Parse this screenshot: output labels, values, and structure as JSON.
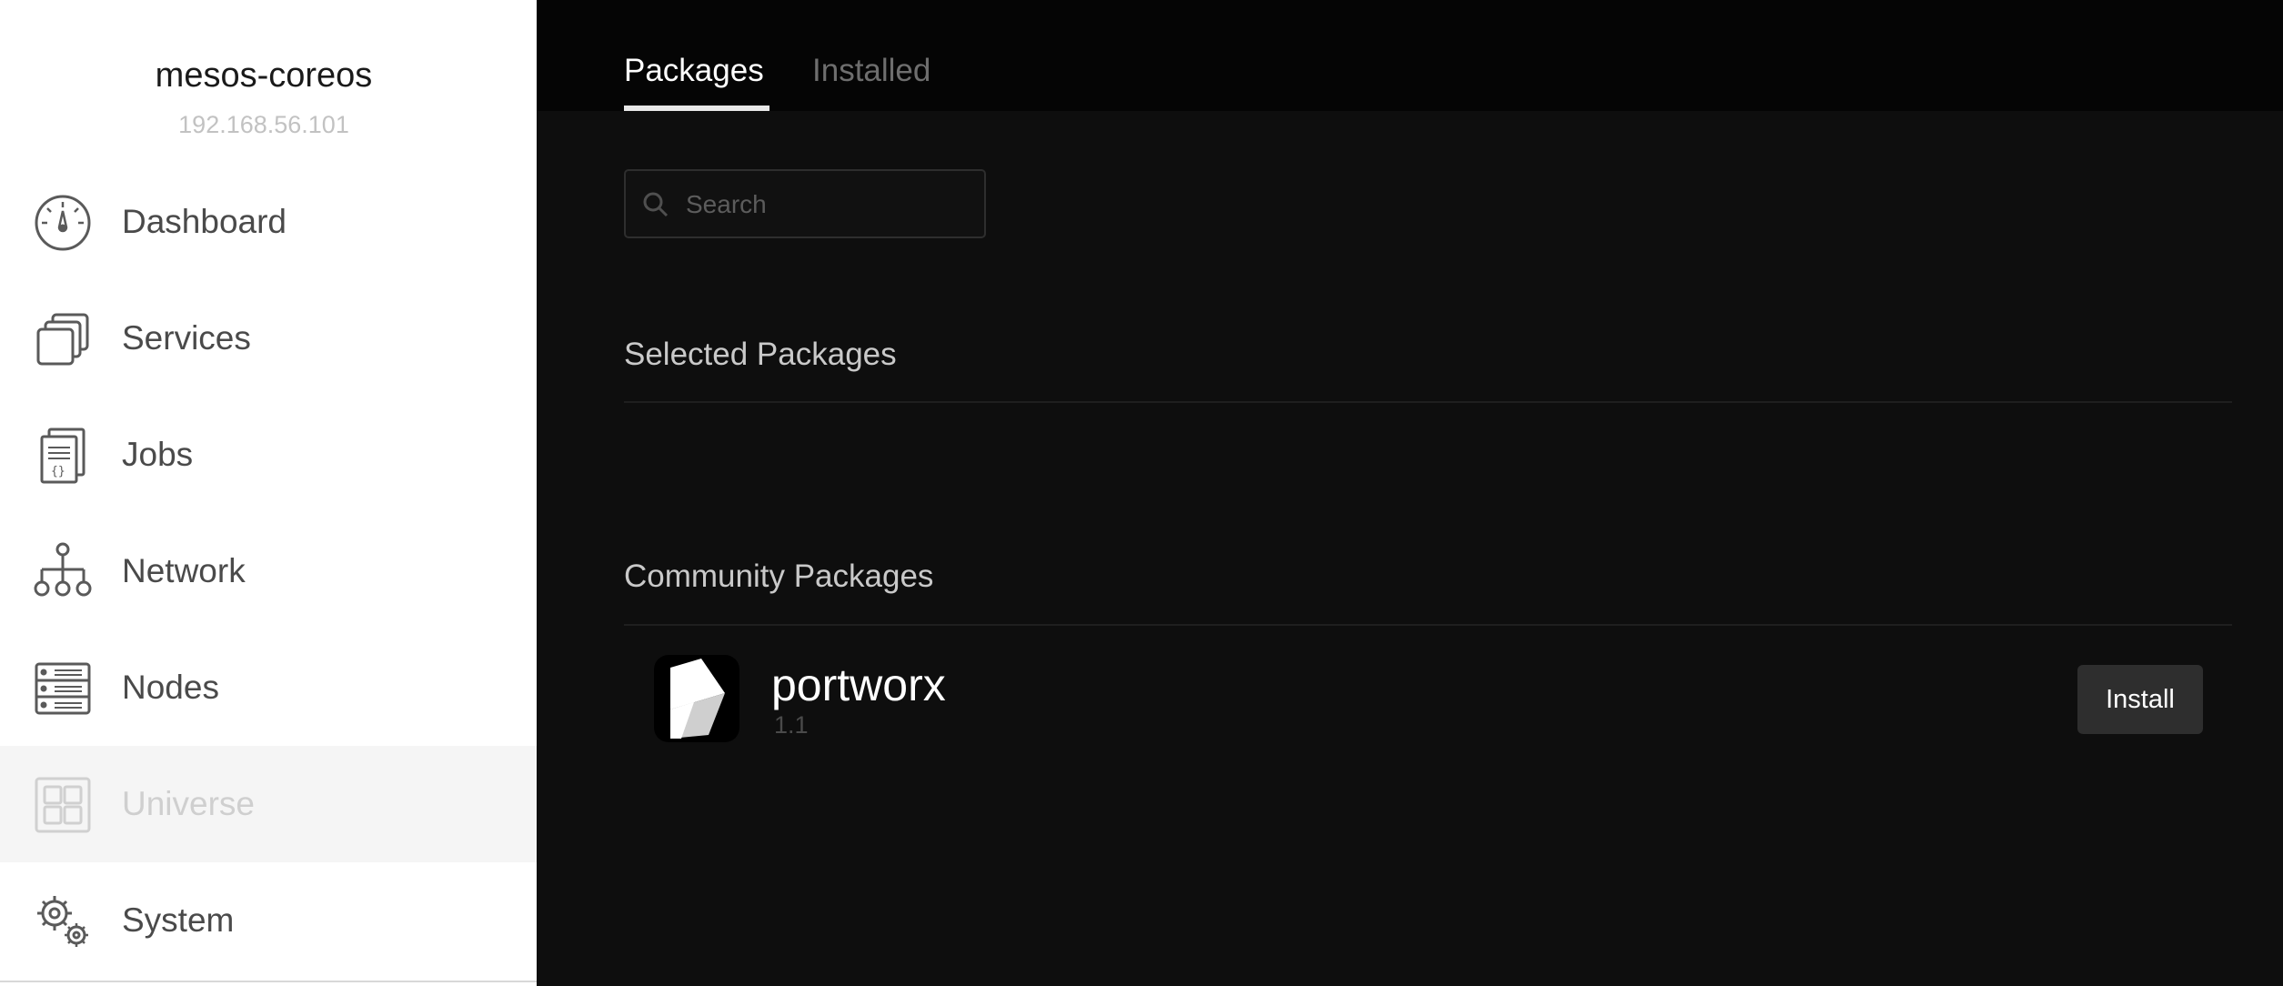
{
  "sidebar": {
    "cluster_name": "mesos-coreos",
    "cluster_ip": "192.168.56.101",
    "items": [
      {
        "label": "Dashboard",
        "icon": "dashboard-gauge-icon",
        "active": false
      },
      {
        "label": "Services",
        "icon": "services-stack-icon",
        "active": false
      },
      {
        "label": "Jobs",
        "icon": "jobs-document-icon",
        "active": false
      },
      {
        "label": "Network",
        "icon": "network-tree-icon",
        "active": false
      },
      {
        "label": "Nodes",
        "icon": "nodes-server-icon",
        "active": false
      },
      {
        "label": "Universe",
        "icon": "universe-grid-icon",
        "active": true
      },
      {
        "label": "System",
        "icon": "system-gears-icon",
        "active": false
      }
    ]
  },
  "main": {
    "tabs": [
      {
        "label": "Packages",
        "active": true
      },
      {
        "label": "Installed",
        "active": false
      }
    ],
    "search": {
      "placeholder": "Search",
      "value": ""
    },
    "selected_section": {
      "title": "Selected Packages"
    },
    "community_section": {
      "title": "Community Packages"
    },
    "packages": [
      {
        "name": "portworx",
        "version": "1.1",
        "action_label": "Install",
        "icon": "portworx-logo-icon"
      }
    ]
  },
  "colors": {
    "sidebar_bg": "#ffffff",
    "active_item_bg": "#f5f5f5",
    "main_bg": "#0e0e0e",
    "topbar_bg": "#050505",
    "button_bg": "#2e2e2e"
  }
}
